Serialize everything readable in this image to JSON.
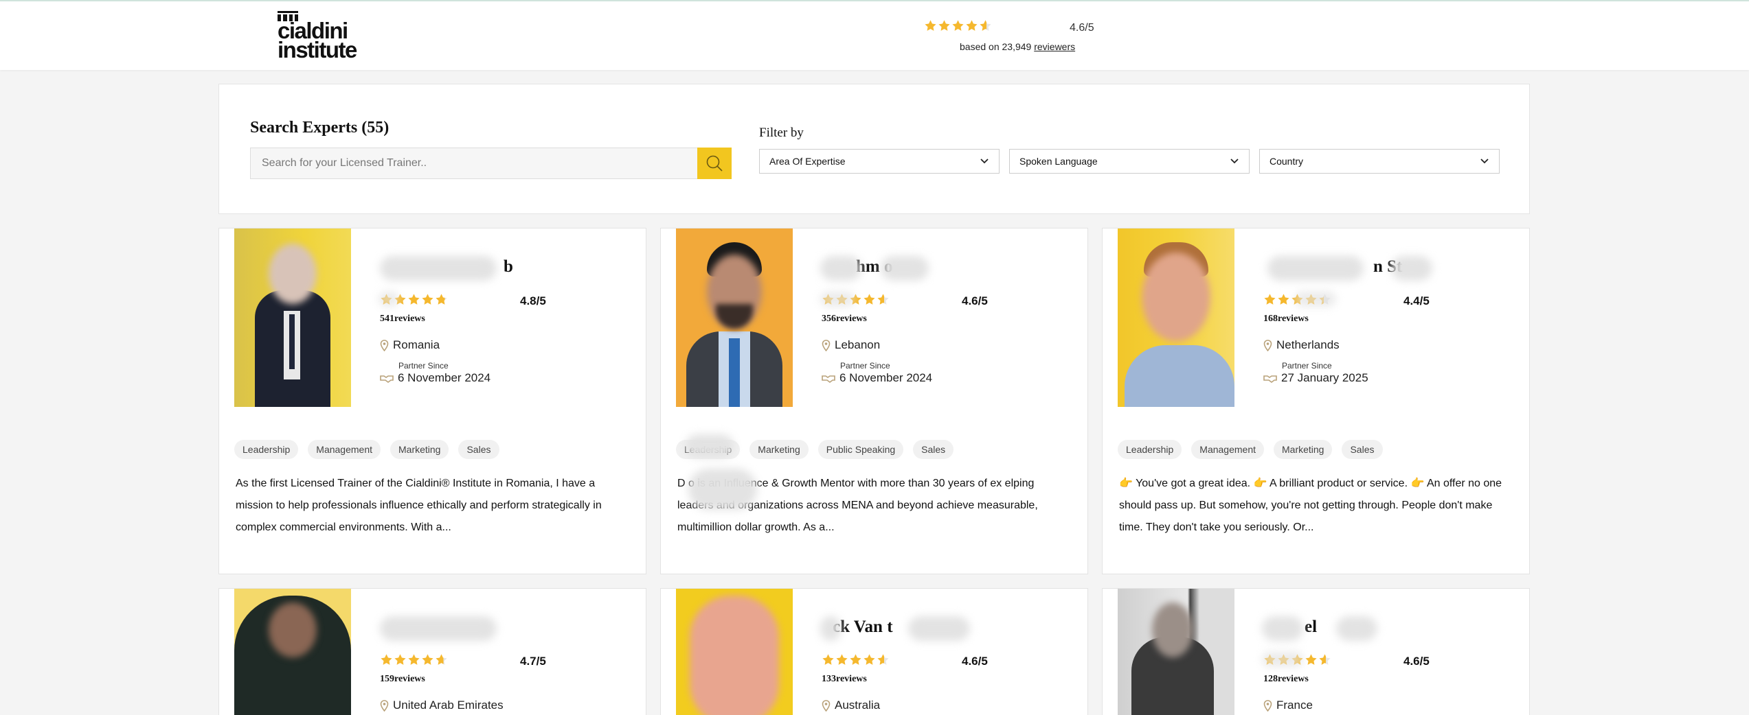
{
  "header": {
    "logo_line1": "cialdini",
    "logo_line2": "institute",
    "rating_score": "4.6/5",
    "rating_value": 4.6,
    "based_on": "based on 23,949",
    "reviewers_link": "reviewers"
  },
  "search": {
    "title": "Search Experts (55)",
    "placeholder": "Search for your Licensed Trainer..",
    "filter_label": "Filter by",
    "filters": [
      "Area Of Expertise",
      "Spoken Language",
      "Country"
    ]
  },
  "colors": {
    "accent": "#f2c61f",
    "star": "#f5b82e",
    "pin": "#b9a27a"
  },
  "partner_since_label": "Partner Since",
  "experts": [
    {
      "name_visible": "b",
      "score": "4.8/5",
      "rating": 4.8,
      "reviews": "541reviews",
      "country": "Romania",
      "partner_since": "6 November 2024",
      "tags": [
        "Leadership",
        "Management",
        "Marketing",
        "Sales"
      ],
      "bio": "As the first Licensed Trainer of the Cialdini® Institute in Romania, I have a mission to help professionals influence ethically and perform strategically in complex commercial environments. With a..."
    },
    {
      "name_visible": "hm o",
      "score": "4.6/5",
      "rating": 4.6,
      "reviews": "356reviews",
      "country": "Lebanon",
      "partner_since": "6 November 2024",
      "tags": [
        "Leadership",
        "Marketing",
        "Public Speaking",
        "Sales"
      ],
      "bio": "D o is an Influence & Growth Mentor with more than 30 years of ex elping leaders and organizations across MENA and beyond achieve measurable, multimillion dollar growth. As a..."
    },
    {
      "name_visible": "n St",
      "score": "4.4/5",
      "rating": 4.4,
      "reviews": "168reviews",
      "country": "Netherlands",
      "partner_since": "27 January 2025",
      "tags": [
        "Leadership",
        "Management",
        "Marketing",
        "Sales"
      ],
      "bio": "👉 You've got a great idea. 👉 A brilliant product or service. 👉 An offer no one should pass up. But somehow, you're not getting through. People don't make time. They don't take you seriously. Or..."
    },
    {
      "name_visible": "",
      "score": "4.7/5",
      "rating": 4.7,
      "reviews": "159reviews",
      "country": "United Arab Emirates"
    },
    {
      "name_visible": "ck Van t",
      "score": "4.6/5",
      "rating": 4.6,
      "reviews": "133reviews",
      "country": "Australia"
    },
    {
      "name_visible": "el",
      "score": "4.6/5",
      "rating": 4.6,
      "reviews": "128reviews",
      "country": "France"
    }
  ]
}
